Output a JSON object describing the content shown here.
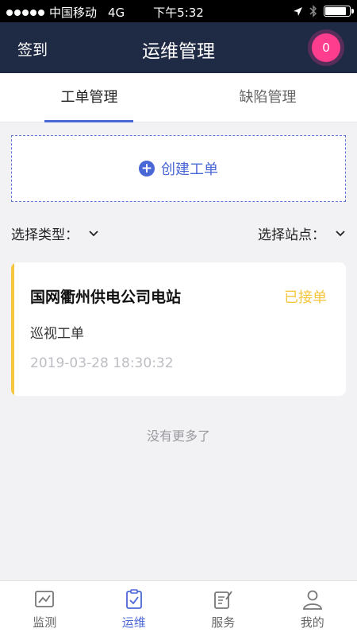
{
  "status_bar": {
    "carrier": "中国移动",
    "network": "4G",
    "time": "下午5:32"
  },
  "navbar": {
    "left_action": "签到",
    "title": "运维管理",
    "badge_count": "0"
  },
  "tabs": [
    {
      "label": "工单管理",
      "active": true
    },
    {
      "label": "缺陷管理",
      "active": false
    }
  ],
  "create_button": {
    "label": "创建工单",
    "icon": "plus-circle-icon"
  },
  "filters": {
    "type_label": "选择类型：",
    "station_label": "选择站点："
  },
  "work_orders": [
    {
      "title": "国网衢州供电公司电站",
      "status": "已接单",
      "type": "巡视工单",
      "time": "2019-03-28 18:30:32"
    }
  ],
  "list_footer": "没有更多了",
  "tabbar": [
    {
      "label": "监测",
      "icon": "chart-icon",
      "active": false
    },
    {
      "label": "运维",
      "icon": "clipboard-check-icon",
      "active": true
    },
    {
      "label": "服务",
      "icon": "edit-document-icon",
      "active": false
    },
    {
      "label": "我的",
      "icon": "user-icon",
      "active": false
    }
  ],
  "colors": {
    "navbar_bg": "#1f2a44",
    "accent": "#4a67d6",
    "status_pending": "#f6c63e",
    "badge": "#ff3d8f"
  }
}
